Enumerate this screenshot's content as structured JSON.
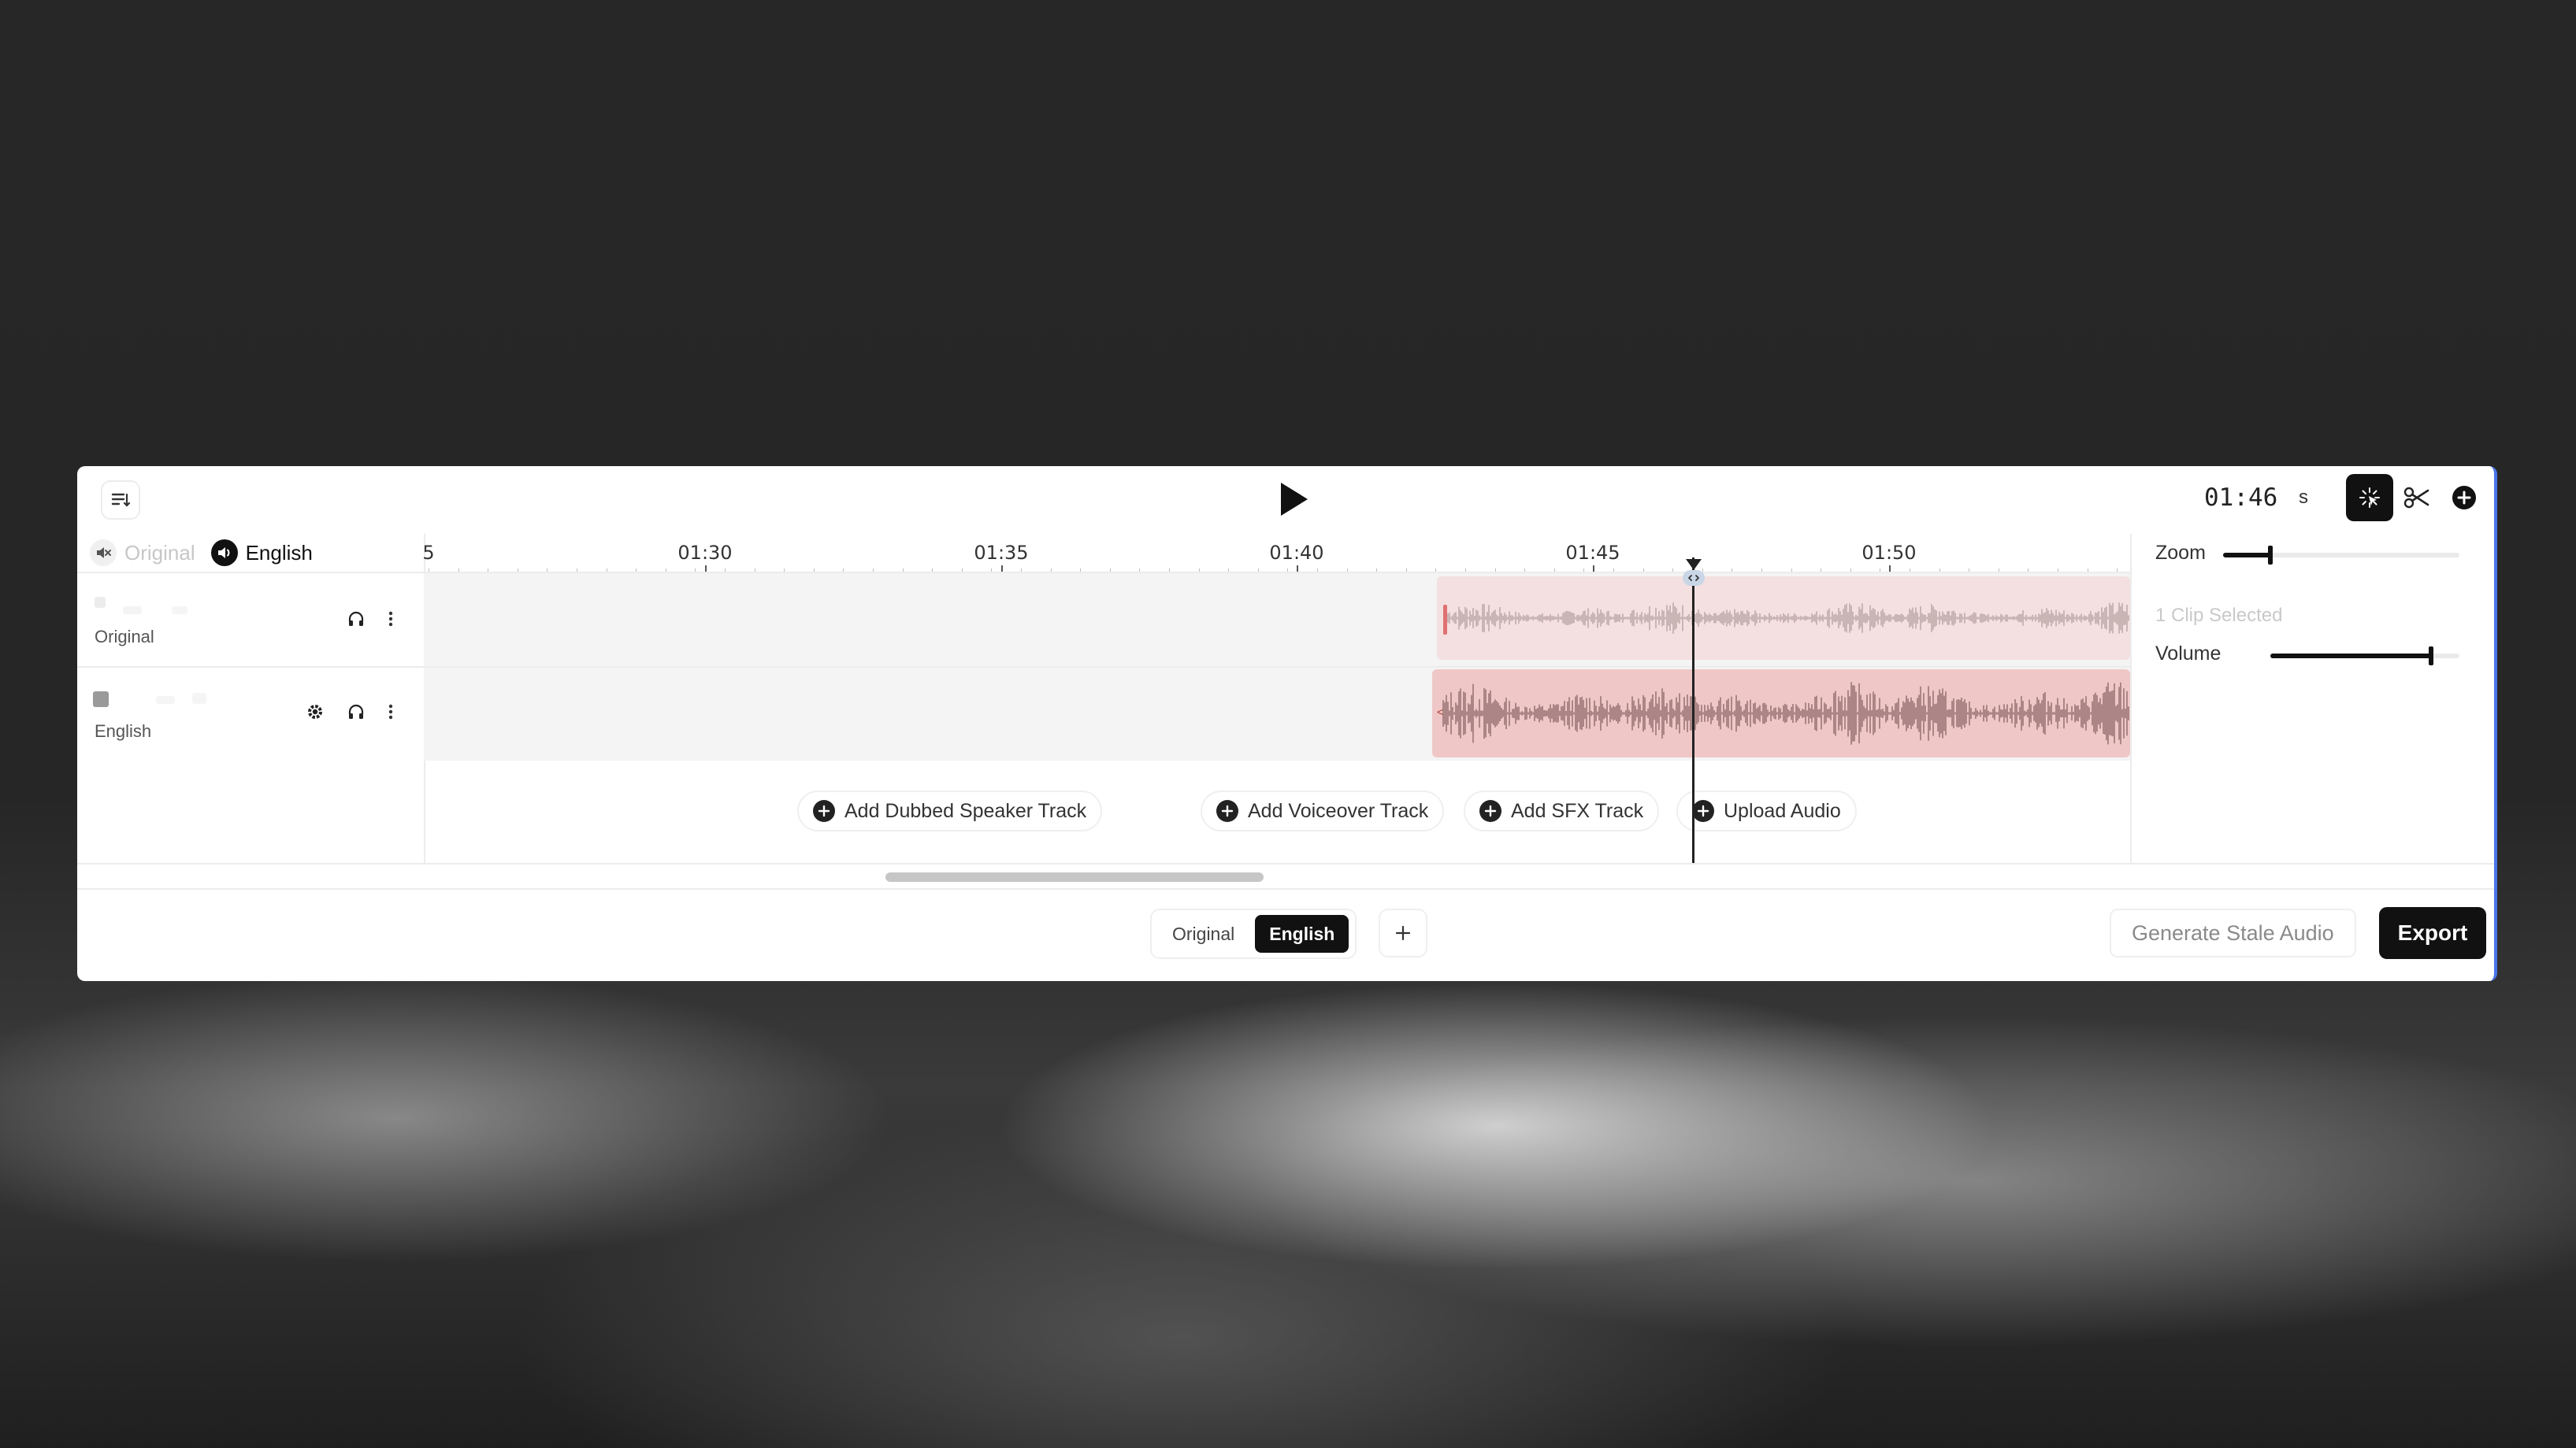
{
  "toolbar": {
    "time": "01:46",
    "time_unit": "s"
  },
  "language_toggle": {
    "original_label": "Original",
    "english_label": "English"
  },
  "tracks": [
    {
      "name": "Original"
    },
    {
      "name": "English"
    }
  ],
  "ruler": {
    "labels": [
      "5",
      "01:30",
      "01:35",
      "01:40",
      "01:45",
      "01:50"
    ]
  },
  "add_actions": {
    "dubbed_speaker": "Add Dubbed Speaker Track",
    "voiceover": "Add Voiceover Track",
    "sfx": "Add SFX Track",
    "upload": "Upload Audio"
  },
  "right_panel": {
    "zoom_label": "Zoom",
    "zoom_level": 0.2,
    "clip_selected": "1 Clip Selected",
    "volume_label": "Volume",
    "volume_level": 0.85
  },
  "bottom": {
    "tabs": [
      {
        "label": "Original",
        "active": false
      },
      {
        "label": "English",
        "active": true
      }
    ],
    "generate_stale": "Generate Stale Audio",
    "export": "Export"
  },
  "colors": {
    "accent": "#111111",
    "clip_original": "#f4e0e0",
    "clip_english": "#efc7c7",
    "window_edge": "#4b74e8"
  },
  "icons": [
    "toc-icon",
    "play-icon",
    "pointer-icon",
    "scissors-icon",
    "plus-circle-icon",
    "mute-icon",
    "speaker-icon",
    "headphones-icon",
    "more-vertical-icon",
    "gear-icon",
    "plus-icon"
  ]
}
